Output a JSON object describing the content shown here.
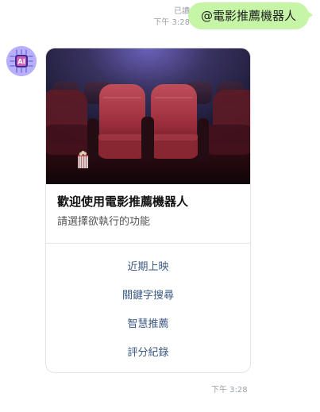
{
  "outgoing": {
    "read_label": "已讀",
    "time": "下午 3:28",
    "message": "@電影推薦機器人"
  },
  "bot": {
    "avatar_icon": "ai-chip-icon",
    "card": {
      "image_icon": "cinema-seats-image",
      "title": "歡迎使用電影推薦機器人",
      "subtitle": "請選擇欲執行的功能",
      "actions": [
        {
          "label": "近期上映"
        },
        {
          "label": "關鍵字搜尋"
        },
        {
          "label": "智慧推薦"
        },
        {
          "label": "評分紀錄"
        }
      ]
    },
    "time": "下午 3:28"
  },
  "colors": {
    "outgoing_bubble": "#c6f5a7",
    "action_text": "#3b5a84",
    "meta_text": "#9aa0a6"
  }
}
